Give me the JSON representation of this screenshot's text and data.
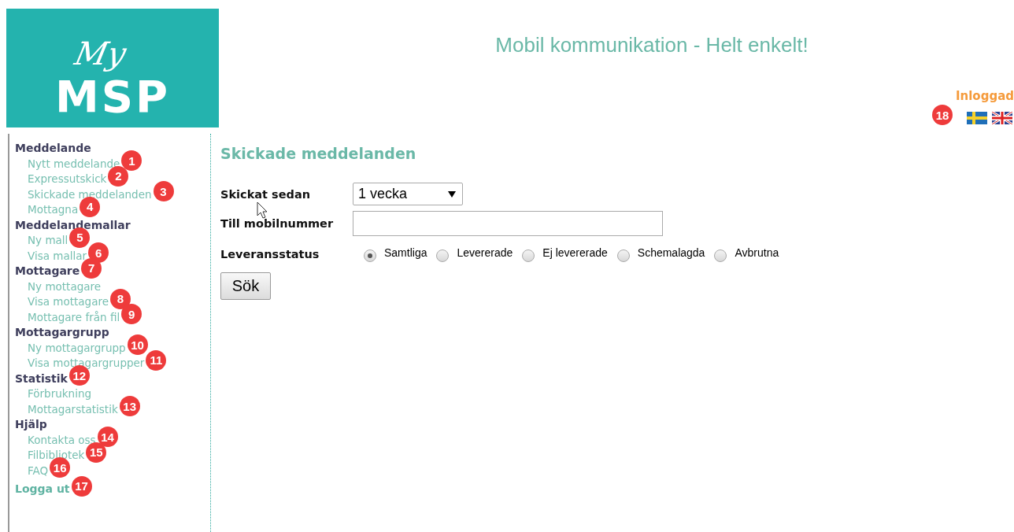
{
  "logo": {
    "script": "My",
    "word": "MSP"
  },
  "tagline": "Mobil kommunikation -  Helt enkelt!",
  "login": {
    "status": "Inloggad",
    "callout": "18"
  },
  "languages": [
    {
      "kind": "sv"
    },
    {
      "kind": "en"
    }
  ],
  "sidebar": {
    "sections": [
      {
        "heading": "Meddelande",
        "items": [
          {
            "label": "Nytt meddelande",
            "callout": "1"
          },
          {
            "label": "Expressutskick",
            "callout": "2"
          },
          {
            "label": "Skickade meddelanden",
            "callout": "3"
          },
          {
            "label": "Mottagna",
            "callout": "4"
          }
        ]
      },
      {
        "heading": "Meddelandemallar",
        "items": [
          {
            "label": "Ny mall",
            "callout": "5"
          },
          {
            "label": "Visa mallar",
            "callout": "6"
          }
        ]
      },
      {
        "heading": "Mottagare",
        "callout": "7",
        "items": [
          {
            "label": "Ny mottagare"
          },
          {
            "label": "Visa mottagare",
            "callout": "8"
          },
          {
            "label": "Mottagare från fil",
            "callout": "9"
          }
        ]
      },
      {
        "heading": "Mottagargrupp",
        "items": [
          {
            "label": "Ny mottagargrupp",
            "callout": "10"
          },
          {
            "label": "Visa mottagargrupper",
            "callout": "11"
          }
        ]
      },
      {
        "heading": "Statistik",
        "callout": "12",
        "items": [
          {
            "label": "Förbrukning"
          },
          {
            "label": "Mottagarstatistik",
            "callout": "13"
          }
        ]
      },
      {
        "heading": "Hjälp",
        "items": [
          {
            "label": "Kontakta oss",
            "callout": "14"
          },
          {
            "label": "Filbibliotek",
            "callout": "15"
          },
          {
            "label": "FAQ",
            "callout": "16"
          }
        ]
      }
    ],
    "logout": {
      "label": "Logga ut",
      "callout": "17"
    }
  },
  "page_title": "Skickade meddelanden",
  "form": {
    "sent_since": {
      "label": "Skickat sedan",
      "value": "1 vecka"
    },
    "mobile": {
      "label": "Till mobilnummer"
    },
    "status": {
      "label": "Leveransstatus",
      "options": [
        {
          "label": "Samtliga",
          "selected": true
        },
        {
          "label": "Levererade",
          "selected": false
        },
        {
          "label": "Ej levererade",
          "selected": false
        },
        {
          "label": "Schemalagda",
          "selected": false
        },
        {
          "label": "Avbrutna",
          "selected": false
        }
      ]
    },
    "submit": "Sök"
  }
}
